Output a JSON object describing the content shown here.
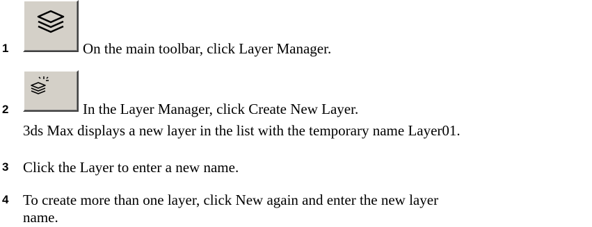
{
  "steps": [
    {
      "number": "1",
      "icon": "layer-manager-icon",
      "text": "On the main toolbar, click Layer Manager."
    },
    {
      "number": "2",
      "icon": "create-new-layer-icon",
      "text": "In the Layer Manager, click Create New Layer.",
      "note": "3ds Max displays a new layer in the list with the temporary name Layer01."
    },
    {
      "number": "3",
      "text": "Click the Layer to enter a new name."
    },
    {
      "number": "4",
      "text_line1": "To create more than one layer, click New again and enter the new layer",
      "text_line2": "name."
    }
  ]
}
